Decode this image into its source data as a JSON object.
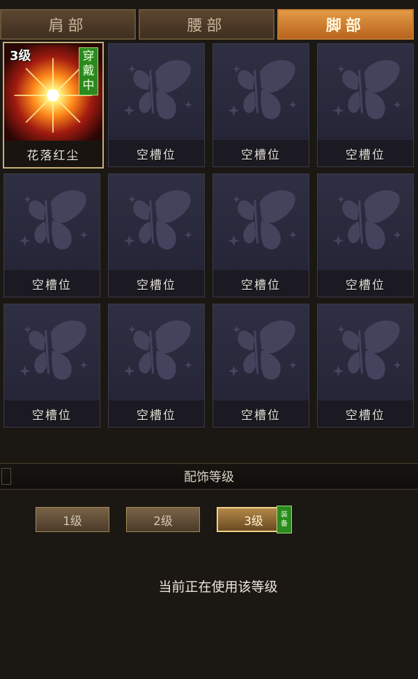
{
  "tabs": [
    {
      "label": "肩部",
      "active": false
    },
    {
      "label": "腰部",
      "active": false
    },
    {
      "label": "脚部",
      "active": true
    }
  ],
  "slots": [
    {
      "label": "花落红尘",
      "level": "3级",
      "badge": "穿戴中",
      "filled": true,
      "icon": "sunburst-flame-icon"
    },
    {
      "label": "空槽位",
      "filled": false,
      "icon": "butterfly-icon"
    },
    {
      "label": "空槽位",
      "filled": false,
      "icon": "butterfly-icon"
    },
    {
      "label": "空槽位",
      "filled": false,
      "icon": "butterfly-icon"
    },
    {
      "label": "空槽位",
      "filled": false,
      "icon": "butterfly-icon"
    },
    {
      "label": "空槽位",
      "filled": false,
      "icon": "butterfly-icon"
    },
    {
      "label": "空槽位",
      "filled": false,
      "icon": "butterfly-icon"
    },
    {
      "label": "空槽位",
      "filled": false,
      "icon": "butterfly-icon"
    },
    {
      "label": "空槽位",
      "filled": false,
      "icon": "butterfly-icon"
    },
    {
      "label": "空槽位",
      "filled": false,
      "icon": "butterfly-icon"
    },
    {
      "label": "空槽位",
      "filled": false,
      "icon": "butterfly-icon"
    },
    {
      "label": "空槽位",
      "filled": false,
      "icon": "butterfly-icon"
    }
  ],
  "section": {
    "title": "配饰等级"
  },
  "levels": [
    {
      "label": "1级",
      "active": false
    },
    {
      "label": "2级",
      "active": false
    },
    {
      "label": "3级",
      "active": true
    }
  ],
  "equip_tag": {
    "top": "装",
    "bottom": "备"
  },
  "status": "当前正在使用该等级",
  "colors": {
    "accent": "#d98a3a",
    "worn_badge": "#2a8a1e",
    "slot_bg": "#2b2a3d"
  }
}
